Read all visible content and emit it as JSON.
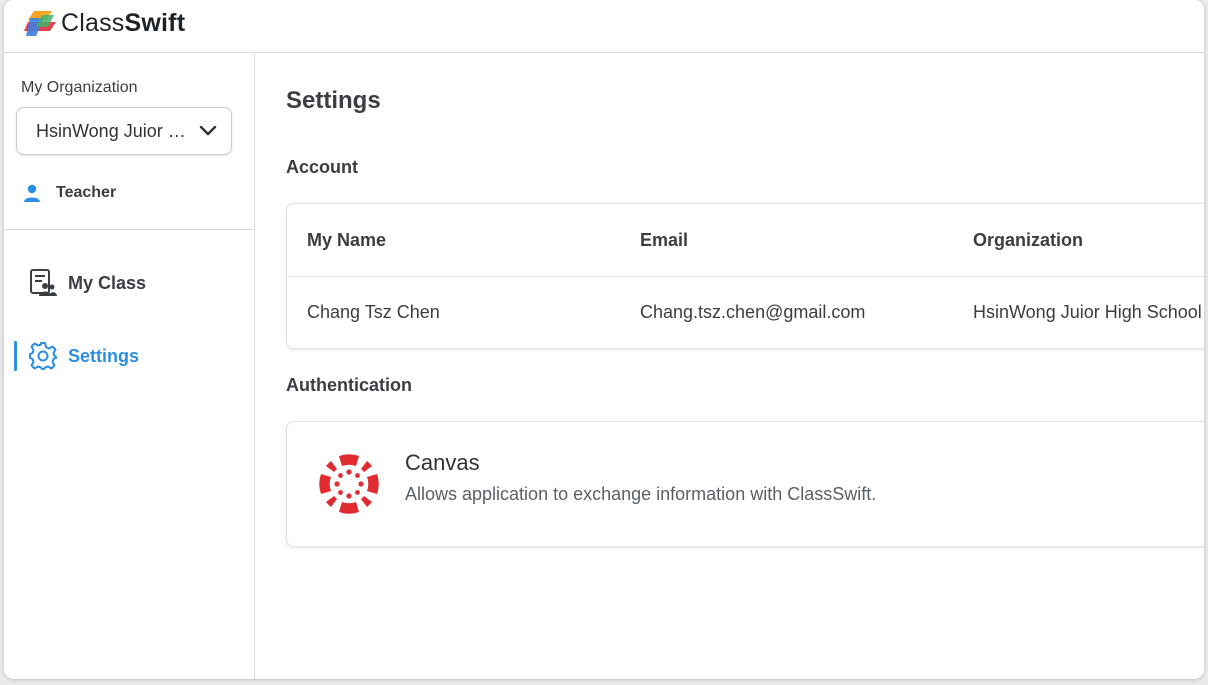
{
  "app": {
    "brand_light": "Class",
    "brand_bold": "Swift"
  },
  "sidebar": {
    "org_label": "My Organization",
    "org_selected": "HsinWong Juior High School",
    "role": "Teacher",
    "role_icon": "user-icon",
    "items": [
      {
        "label": "My Class",
        "icon": "class-roster-icon",
        "active": false
      },
      {
        "label": "Settings",
        "icon": "gear-icon",
        "active": true
      }
    ]
  },
  "main": {
    "title": "Settings",
    "account": {
      "section_title": "Account",
      "columns": [
        "My Name",
        "Email",
        "Organization"
      ],
      "row": [
        "Chang Tsz Chen",
        "Chang.tsz.chen@gmail.com",
        "HsinWong Juior High School"
      ]
    },
    "authentication": {
      "section_title": "Authentication",
      "integrations": [
        {
          "name": "Canvas",
          "icon": "canvas-logo-icon",
          "description": "Allows application to exchange information with ClassSwift."
        }
      ]
    }
  },
  "colors": {
    "accent": "#2d8fe3",
    "canvas_red": "#e02b30",
    "text": "#3a3e43"
  }
}
